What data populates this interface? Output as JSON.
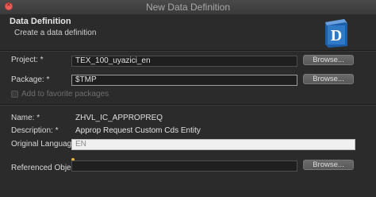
{
  "window": {
    "title": "New Data Definition"
  },
  "header": {
    "title": "Data Definition",
    "subtitle": "Create a data definition"
  },
  "form": {
    "project": {
      "label": "Project: *",
      "value": "TEX_100_uyazici_en",
      "button": "Browse..."
    },
    "package": {
      "label": "Package: *",
      "value": "$TMP",
      "button": "Browse..."
    },
    "add_favorite": {
      "label": "Add to favorite packages",
      "checked": false
    },
    "name": {
      "label": "Name: *",
      "value": "ZHVL_IC_APPROPREQ"
    },
    "description": {
      "label": "Description: *",
      "value": "Approp Request Custom Cds Entity"
    },
    "original_language": {
      "label": "Original Language:",
      "value": "EN"
    },
    "referenced_object": {
      "label": "Referenced Object:",
      "value": "",
      "button": "Browse..."
    }
  },
  "logo": {
    "letter": "D"
  }
}
